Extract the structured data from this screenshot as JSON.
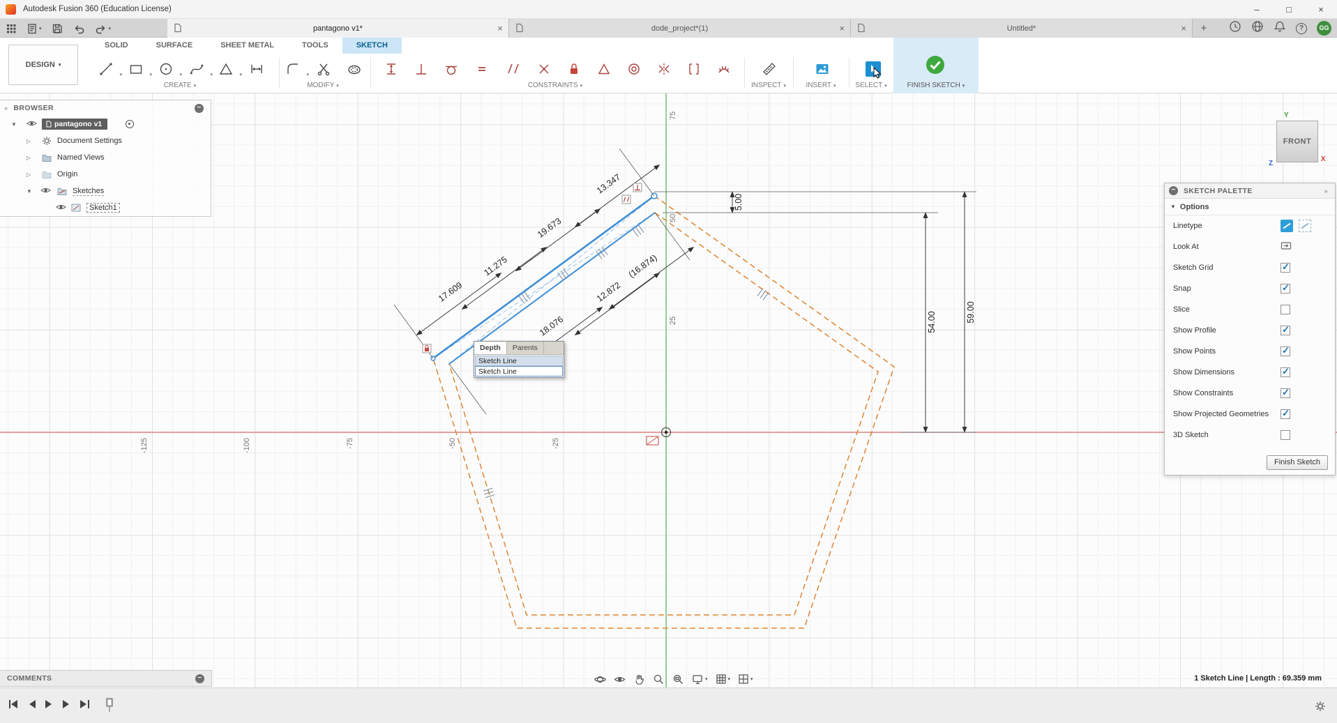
{
  "colors": {
    "accent_blue": "#0696d7",
    "finish_green": "#3fa83f",
    "sketch_orange": "#e0832f",
    "selection_blue": "#3f8fd6",
    "axis_red": "#d9534f",
    "axis_green": "#5cb85c"
  },
  "icons": {
    "chevron_down": "▾",
    "tree_open": "▼",
    "tree_closed": "▷",
    "panel_minus": "−",
    "collapse_left": "«",
    "expand_right": "»",
    "plus": "+",
    "close": "×",
    "minimize": "–",
    "maximize": "□",
    "question": "?",
    "check": "✓"
  },
  "titlebar": {
    "app_title": "Autodesk Fusion 360 (Education License)"
  },
  "tabbar": {
    "tabs": [
      {
        "label": "pantagono v1*",
        "active": true
      },
      {
        "label": "dode_project*(1)",
        "active": false
      },
      {
        "label": "Untitled*",
        "active": false
      }
    ],
    "profile_initials": "GG"
  },
  "ribbon": {
    "design_selector": "DESIGN",
    "tabs": [
      {
        "label": "SOLID",
        "active": false
      },
      {
        "label": "SURFACE",
        "active": false
      },
      {
        "label": "SHEET METAL",
        "active": false
      },
      {
        "label": "TOOLS",
        "active": false
      },
      {
        "label": "SKETCH",
        "active": true
      }
    ],
    "group_labels": {
      "create": "CREATE",
      "modify": "MODIFY",
      "constraints": "CONSTRAINTS",
      "inspect": "INSPECT",
      "insert": "INSERT",
      "select": "SELECT",
      "finish_sketch": "FINISH SKETCH"
    }
  },
  "browser": {
    "header": "BROWSER",
    "root": {
      "label": "pantagono v1"
    },
    "items": [
      {
        "label": "Document Settings"
      },
      {
        "label": "Named Views"
      },
      {
        "label": "Origin"
      },
      {
        "label": "Sketches"
      },
      {
        "label": "Sketch1"
      }
    ]
  },
  "viewcube": {
    "face": "FRONT",
    "axis_x": "X",
    "axis_y": "Y",
    "axis_z": "Z"
  },
  "canvas": {
    "x_axis_labels": [
      "-125",
      "-100",
      "-75",
      "-50",
      "-25"
    ],
    "y_axis_labels": [
      "75",
      "50",
      "25"
    ],
    "dimension_labels": [
      "17.609",
      "11.275",
      "19.673",
      "13.347",
      "18.076",
      "12.872",
      "(16.874)",
      "5.00",
      "54.00",
      "59.00"
    ]
  },
  "selection_popup": {
    "tabs": [
      {
        "label": "Depth",
        "active": true
      },
      {
        "label": "Parents",
        "active": false
      }
    ],
    "items": [
      {
        "label": "Sketch Line"
      },
      {
        "label": "Sketch Line"
      }
    ]
  },
  "sketch_palette": {
    "header": "SKETCH PALETTE",
    "section_options": "Options",
    "options": [
      {
        "label": "Linetype",
        "control": "linetype"
      },
      {
        "label": "Look At",
        "control": "button"
      },
      {
        "label": "Sketch Grid",
        "control": "checkbox",
        "checked": true
      },
      {
        "label": "Snap",
        "control": "checkbox",
        "checked": true
      },
      {
        "label": "Slice",
        "control": "checkbox",
        "checked": false
      },
      {
        "label": "Show Profile",
        "control": "checkbox",
        "checked": true
      },
      {
        "label": "Show Points",
        "control": "checkbox",
        "checked": true
      },
      {
        "label": "Show Dimensions",
        "control": "checkbox",
        "checked": true
      },
      {
        "label": "Show Constraints",
        "control": "checkbox",
        "checked": true
      },
      {
        "label": "Show Projected Geometries",
        "control": "checkbox",
        "checked": true
      },
      {
        "label": "3D Sketch",
        "control": "checkbox",
        "checked": false
      }
    ],
    "finish_button": "Finish Sketch"
  },
  "comments": {
    "header": "COMMENTS"
  },
  "status": {
    "selection_info": "1 Sketch Line | Length : 69.359 mm"
  }
}
